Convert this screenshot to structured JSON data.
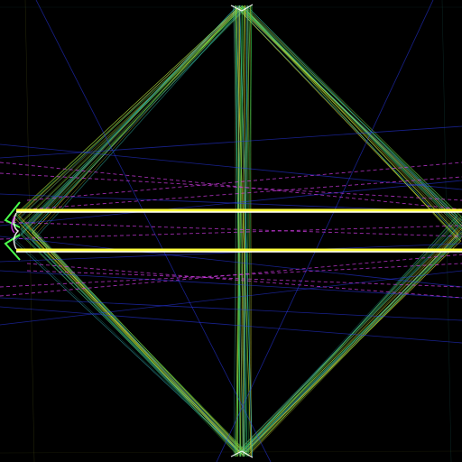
{
  "scene": {
    "background": "#000000",
    "palette": {
      "green": "#39d353",
      "olive": "#9aa52a",
      "teal": "#2a9d8f",
      "cyan": "#3fd3e0",
      "blue": "#2b3dff",
      "magenta": "#d23be6",
      "yellow": "#ffff3a",
      "white": "#ffffff",
      "lime": "#4cff4c"
    },
    "description_tokens": [
      "diamond-ray-bundle",
      "vertical-ray-bundle",
      "horizontal-beam-pair",
      "magenta-dashed-crossings",
      "blue-crossings",
      "left-emitter-marks"
    ]
  }
}
